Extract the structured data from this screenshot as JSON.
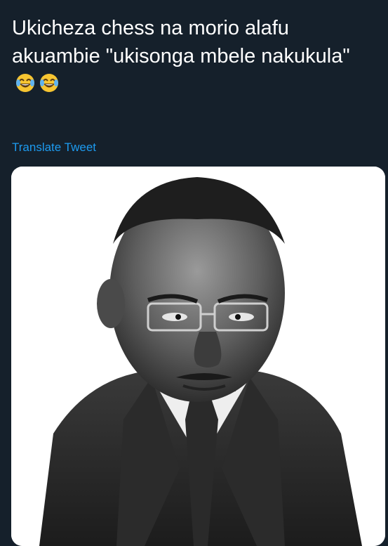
{
  "tweet": {
    "text": "Ukicheza chess na morio alafu akuambie \"ukisonga mbele nakukula\"",
    "emojis": [
      "face-with-tears-of-joy-icon",
      "face-with-tears-of-joy-icon"
    ],
    "translate_label": "Translate Tweet"
  },
  "media": {
    "alt": "caricature-man-glasses-suit-tie",
    "background": "#ffffff"
  },
  "colors": {
    "background": "#15202b",
    "text": "#ffffff",
    "link": "#1d9bf0",
    "emoji_face": "#f7c531"
  }
}
